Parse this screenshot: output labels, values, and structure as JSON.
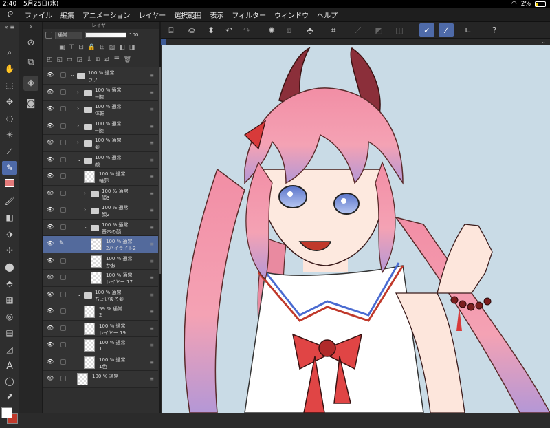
{
  "status": {
    "time": "2:40",
    "date": "5月25日(水)",
    "battery": "2%"
  },
  "menu": [
    "ファイル",
    "編集",
    "アニメーション",
    "レイヤー",
    "選択範囲",
    "表示",
    "フィルター",
    "ウィンドウ",
    "ヘルプ"
  ],
  "layer_panel": {
    "title": "レイヤー",
    "blend_mode": "通常",
    "opacity": "100"
  },
  "layers": [
    {
      "indent": 0,
      "type": "folder",
      "open": true,
      "l1": "100 % 通常",
      "l2": "ラフ"
    },
    {
      "indent": 1,
      "type": "folder",
      "open": false,
      "l1": "100 % 通常",
      "l2": "→腕"
    },
    {
      "indent": 1,
      "type": "folder",
      "open": false,
      "l1": "100 % 通常",
      "l2": "体幹"
    },
    {
      "indent": 1,
      "type": "folder",
      "open": false,
      "l1": "100 % 通常",
      "l2": "←腕"
    },
    {
      "indent": 1,
      "type": "folder",
      "open": false,
      "l1": "100 % 通常",
      "l2": "髪"
    },
    {
      "indent": 1,
      "type": "folder",
      "open": true,
      "l1": "100 % 通常",
      "l2": "顔"
    },
    {
      "indent": 2,
      "type": "layer",
      "l1": "100 % 通常",
      "l2": "輪郭"
    },
    {
      "indent": 2,
      "type": "folder",
      "open": false,
      "l1": "100 % 通常",
      "l2": "顔3"
    },
    {
      "indent": 2,
      "type": "folder",
      "open": false,
      "l1": "100 % 通常",
      "l2": "顔2"
    },
    {
      "indent": 2,
      "type": "folder",
      "open": true,
      "l1": "100 % 通常",
      "l2": "基本の顔"
    },
    {
      "indent": 3,
      "type": "layer",
      "selected": true,
      "l1": "100 % 通常",
      "l2": "2ハイライト2"
    },
    {
      "indent": 3,
      "type": "layer",
      "l1": "100 % 通常",
      "l2": "かお"
    },
    {
      "indent": 3,
      "type": "layer",
      "l1": "100 % 通常",
      "l2": "レイヤー 17"
    },
    {
      "indent": 1,
      "type": "folder",
      "open": true,
      "l1": "100 % 通常",
      "l2": "ちょい後ろ髪"
    },
    {
      "indent": 2,
      "type": "layer",
      "l1": "59 % 通常",
      "l2": "2"
    },
    {
      "indent": 2,
      "type": "layer",
      "l1": "100 % 通常",
      "l2": "レイヤー 19"
    },
    {
      "indent": 2,
      "type": "layer",
      "l1": "100 % 通常",
      "l2": "1"
    },
    {
      "indent": 2,
      "type": "layer",
      "l1": "100 % 通常",
      "l2": "1色"
    },
    {
      "indent": 1,
      "type": "layer",
      "l1": "100 % 通常",
      "l2": ""
    }
  ],
  "colors": {
    "canvas_bg": "#c9dbe6",
    "accent": "#4e6aa8",
    "main_color": "#ffffff",
    "sub_color": "#c0392b"
  }
}
